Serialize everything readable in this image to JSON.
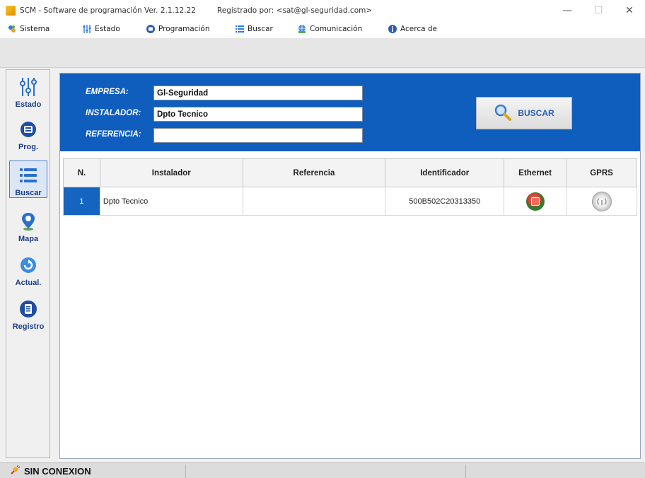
{
  "window": {
    "title": "SCM - Software de programación Ver. 2.1.12.22",
    "registered": "Registrado por:   <sat@gl-seguridad.com>",
    "controls": {
      "minimize": "—",
      "maximize": "☐",
      "close": "✕"
    }
  },
  "menu": {
    "items": [
      {
        "label": "Sistema",
        "icon": "system-icon"
      },
      {
        "label": "Estado",
        "icon": "sliders-icon"
      },
      {
        "label": "Programación",
        "icon": "program-icon"
      },
      {
        "label": "Buscar",
        "icon": "list-icon"
      },
      {
        "label": "Comunicación",
        "icon": "network-icon"
      },
      {
        "label": "Acerca de",
        "icon": "info-icon"
      }
    ]
  },
  "sidebar": {
    "items": [
      {
        "label": "Estado",
        "icon": "sliders-icon"
      },
      {
        "label": "Prog.",
        "icon": "program-icon"
      },
      {
        "label": "Buscar",
        "icon": "list-icon",
        "active": true
      },
      {
        "label": "Mapa",
        "icon": "map-pin-icon"
      },
      {
        "label": "Actual.",
        "icon": "refresh-icon"
      },
      {
        "label": "Registro",
        "icon": "registry-icon"
      }
    ]
  },
  "search": {
    "empresa_label": "EMPRESA:",
    "empresa_value": "Gl-Seguridad",
    "instalador_label": "INSTALADOR:",
    "instalador_value": "Dpto Tecnico",
    "referencia_label": "REFERENCIA:",
    "referencia_value": "",
    "button_label": "BUSCAR"
  },
  "table": {
    "headers": [
      "N.",
      "Instalador",
      "Referencia",
      "Identificador",
      "Ethernet",
      "GPRS"
    ],
    "rows": [
      {
        "n": "1",
        "instalador": "Dpto Tecnico",
        "referencia": "",
        "identificador": "500B502C20313350",
        "ethernet": "connected",
        "gprs": "inactive"
      }
    ]
  },
  "status": {
    "connection": "SIN  CONEXION"
  },
  "colors": {
    "accent": "#0f5dbd",
    "row_number_bg": "#1565c0",
    "label_blue": "#1a3d8a"
  }
}
